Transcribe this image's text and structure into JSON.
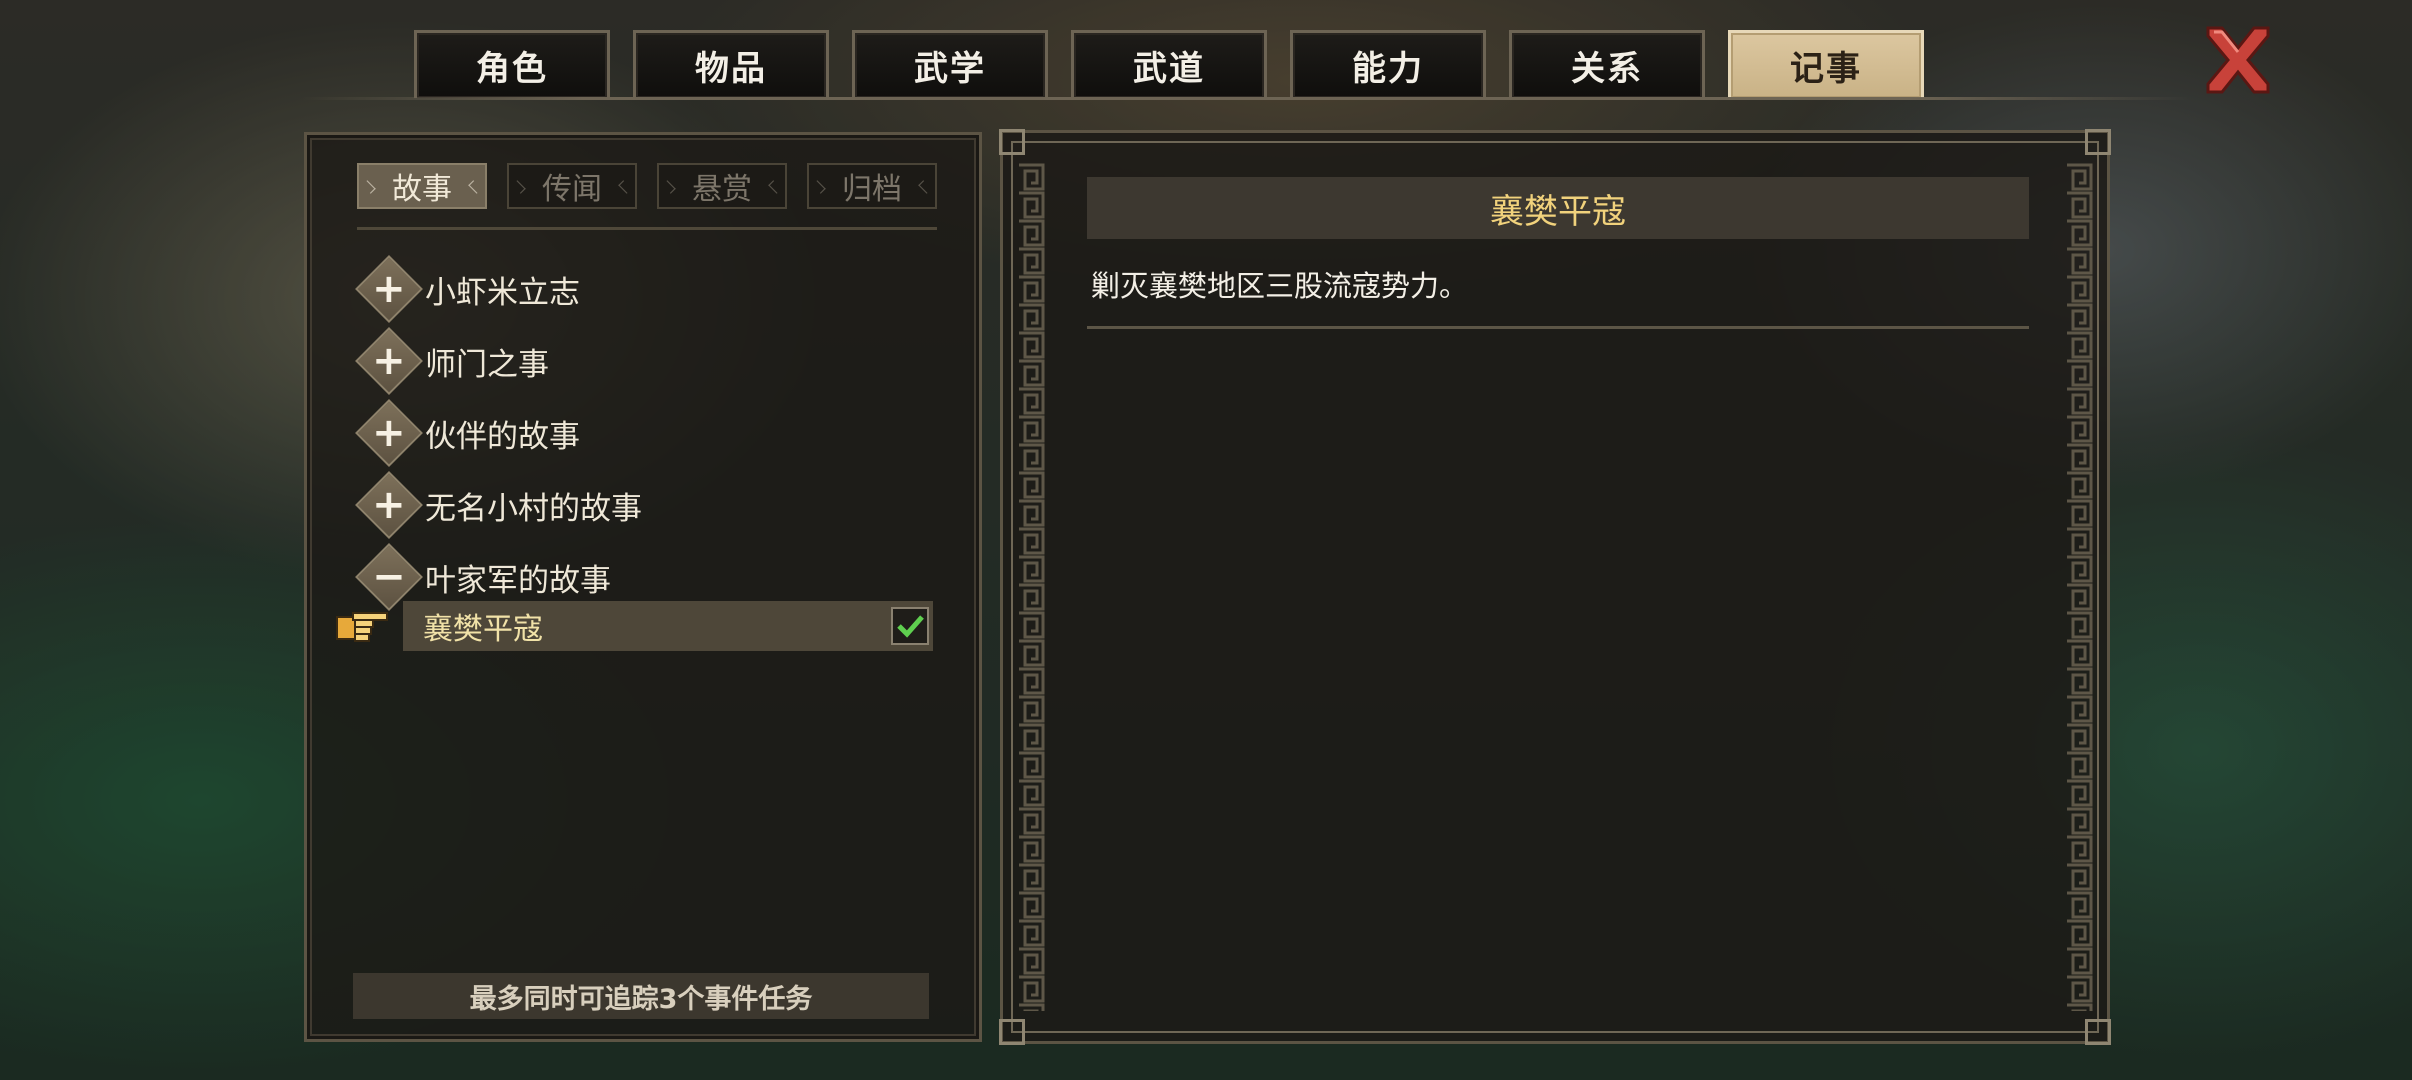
{
  "top_tabs": [
    "角色",
    "物品",
    "武学",
    "武道",
    "能力",
    "关系",
    "记事"
  ],
  "active_top_tab": "记事",
  "sub_tabs": [
    "故事",
    "传闻",
    "悬赏",
    "归档"
  ],
  "active_sub_tab": "故事",
  "stories": [
    {
      "label": "小虾米立志",
      "expander": "+"
    },
    {
      "label": "师门之事",
      "expander": "+"
    },
    {
      "label": "伙伴的故事",
      "expander": "+"
    },
    {
      "label": "无名小村的故事",
      "expander": "+"
    },
    {
      "label": "叶家军的故事",
      "expander": "−"
    }
  ],
  "selected_quest": {
    "label": "襄樊平寇",
    "tracked": true
  },
  "footer_note": "最多同时可追踪3个事件任务",
  "detail": {
    "title": "襄樊平寇",
    "description": "剿灭襄樊地区三股流寇势力。"
  },
  "colors": {
    "accent_gold": "#f1d27c",
    "active_tab": "#dcc7a0",
    "close_red": "#c8423a"
  },
  "icons": {
    "close": "close-icon",
    "pointer": "hand-pointer-icon",
    "check": "checkmark-icon"
  }
}
